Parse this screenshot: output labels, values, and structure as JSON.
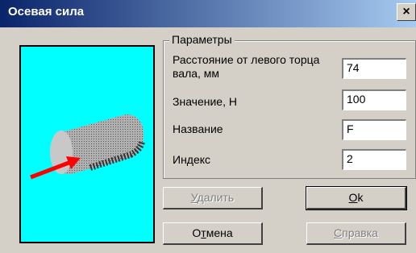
{
  "window": {
    "title": "Осевая сила",
    "close_label": "×"
  },
  "group": {
    "title": "Параметры",
    "fields": [
      {
        "label": "Расстояние от левого торца вала, мм",
        "value": "74"
      },
      {
        "label": "Значение, Н",
        "value": "100"
      },
      {
        "label": "Название",
        "value": "F"
      },
      {
        "label": "Индекс",
        "value": "2"
      }
    ]
  },
  "buttons": {
    "delete": {
      "mnemonic": "У",
      "rest": "далить"
    },
    "ok": {
      "mnemonic": "O",
      "rest": "k"
    },
    "cancel": {
      "prefix": "О",
      "mnemonic": "т",
      "rest": "мена"
    },
    "help": {
      "mnemonic": "С",
      "rest": "правка"
    }
  },
  "colors": {
    "preview_bg": "#00ffff",
    "arrow": "#ff0000",
    "cylinder": "#9a9a9a"
  }
}
